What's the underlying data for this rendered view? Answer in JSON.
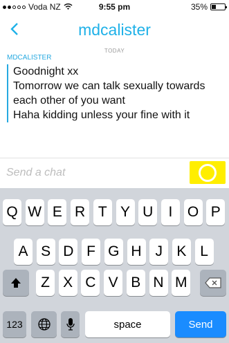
{
  "status": {
    "carrier": "Voda NZ",
    "time": "9:55 pm",
    "battery": "35%",
    "battery_level": 0.35,
    "signal_bars_filled": 2,
    "signal_bars_total": 5
  },
  "nav": {
    "title": "mdcalister",
    "back_icon": "chevron-left-icon"
  },
  "conversation": {
    "day_label": "TODAY",
    "sender": "MDCALISTER",
    "messages": [
      "Goodnight xx",
      "Tomorrow we can talk sexually towards each other of you want",
      "Haha kidding unless your fine with it"
    ]
  },
  "input": {
    "placeholder": "Send a chat",
    "accent_color": "#ffee00",
    "camera_icon": "camera-circle-icon"
  },
  "keyboard": {
    "row1": [
      "Q",
      "W",
      "E",
      "R",
      "T",
      "Y",
      "U",
      "I",
      "O",
      "P"
    ],
    "row2": [
      "A",
      "S",
      "D",
      "F",
      "G",
      "H",
      "J",
      "K",
      "L"
    ],
    "row3": [
      "Z",
      "X",
      "C",
      "V",
      "B",
      "N",
      "M"
    ],
    "shift_icon": "shift-arrow-icon",
    "delete_icon": "backspace-icon",
    "numbers_label": "123",
    "globe_icon": "globe-icon",
    "mic_icon": "microphone-icon",
    "space_label": "space",
    "send_label": "Send"
  },
  "colors": {
    "brand": "#1fb1e8",
    "send_key": "#1a8cff",
    "keyboard_bg": "#d1d5db"
  }
}
